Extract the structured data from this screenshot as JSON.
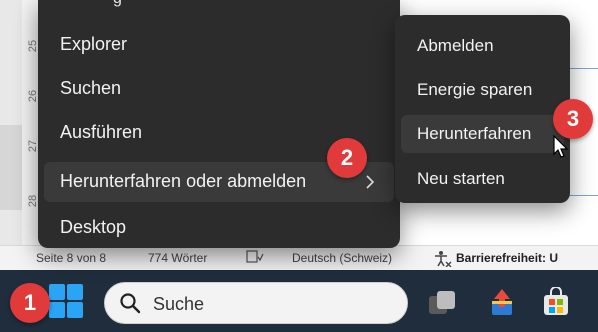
{
  "document": {
    "ruler_numbers": [
      "25",
      "26",
      "27",
      "28"
    ]
  },
  "status_bar": {
    "page": "Seite 8 von 8",
    "words": "774 Wörter",
    "language": "Deutsch (Schweiz)",
    "accessibility": "Barrierefreiheit: U"
  },
  "context_menu": {
    "partial_top": "g",
    "items": [
      {
        "label": "Explorer"
      },
      {
        "label": "Suchen"
      },
      {
        "label": "Ausführen"
      },
      {
        "label": "Herunterfahren oder abmelden"
      },
      {
        "label": "Desktop"
      }
    ]
  },
  "submenu": {
    "items": [
      {
        "label": "Abmelden"
      },
      {
        "label": "Energie sparen"
      },
      {
        "label": "Herunterfahren"
      },
      {
        "label": "Neu starten"
      }
    ]
  },
  "taskbar": {
    "search_placeholder": "Suche"
  },
  "callouts": [
    "1",
    "2",
    "3"
  ],
  "colors": {
    "menu_bg": "#2c2c2c",
    "menu_hover": "#3a3a3a",
    "taskbar_bg": "#1f2d3d",
    "callout": "#e03a3a",
    "windows_blue": "#2aa4f4"
  }
}
